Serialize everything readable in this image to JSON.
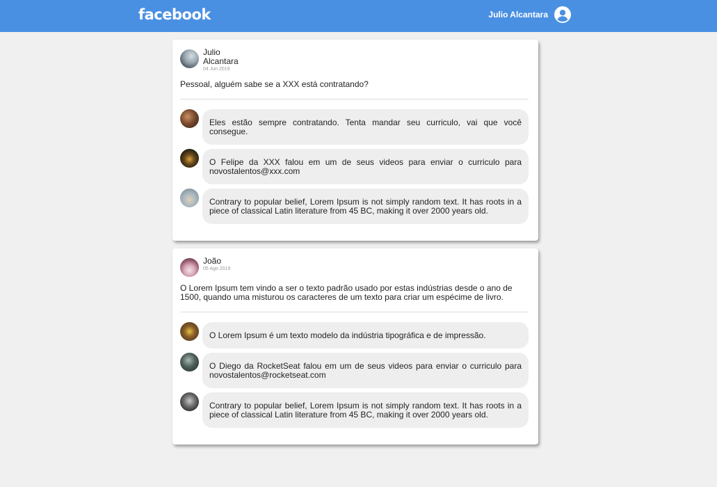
{
  "header": {
    "logo": "facebook",
    "user_name": "Julio Alcantara"
  },
  "posts": [
    {
      "author": "Julio Alcantara",
      "date": "04 Jun 2019",
      "text": "Pessoal, alguém sabe se a XXX está contratando?",
      "comments": [
        {
          "text": "Eles estão sempre contratando. Tenta mandar seu curriculo, vai que você consegue."
        },
        {
          "text": "O Felipe da XXX falou em um de seus videos para enviar o curriculo para novostalentos@xxx.com"
        },
        {
          "text": "Contrary to popular belief, Lorem Ipsum is not simply random text. It has roots in a piece of classical Latin literature from 45 BC, making it over 2000 years old."
        }
      ]
    },
    {
      "author": "João",
      "date": "05 Ago 2019",
      "text": "O Lorem Ipsum tem vindo a ser o texto padrão usado por estas indústrias desde o ano de 1500, quando uma misturou os caracteres de um texto para criar um espécime de livro.",
      "comments": [
        {
          "text": "O Lorem Ipsum é um texto modelo da indústria tipográfica e de impressão."
        },
        {
          "text": "O Diego da RocketSeat falou em um de seus videos para enviar o curriculo para novostalentos@rocketseat.com"
        },
        {
          "text": "Contrary to popular belief, Lorem Ipsum is not simply random text. It has roots in a piece of classical Latin literature from 45 BC, making it over 2000 years old."
        }
      ]
    }
  ],
  "colors": {
    "topbar": "#4a90e2",
    "background": "#f0f0f0",
    "bubble": "#eeeeee"
  }
}
